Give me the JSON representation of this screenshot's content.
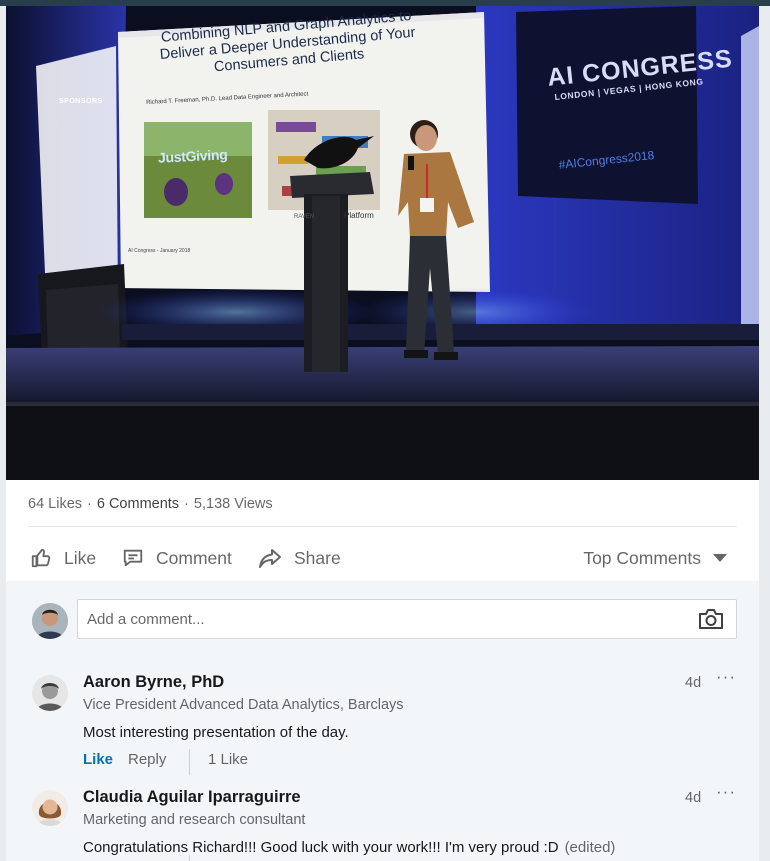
{
  "photo": {
    "slide_title": "Combining NLP and Graph Analytics to Deliver a Deeper Understanding of Your Consumers and Clients",
    "slide_author": "Richard T. Freeman, Ph.D.   Lead Data Engineer and Architect",
    "slide_footer": "AI Congress - January 2018",
    "justgiving_logo": "JustGiving",
    "raven_caption": "RAVEN",
    "platform_caption": "Platform",
    "sponsors_label": "SPONSORS",
    "congress_logo": "AI CONGRESS",
    "congress_cities": "LONDON | VEGAS | HONG KONG",
    "congress_hashtag": "#AICongress2018"
  },
  "social": {
    "likes": "64 Likes",
    "comments": "6 Comments",
    "views": "5,138 Views",
    "separator": "·"
  },
  "actions": {
    "like": "Like",
    "comment": "Comment",
    "share": "Share",
    "sort": "Top Comments"
  },
  "composer": {
    "placeholder": "Add a comment..."
  },
  "comments": [
    {
      "name": "Aaron Byrne, PhD",
      "headline": "Vice President Advanced Data Analytics, Barclays",
      "text": "Most interesting presentation of the day.",
      "time": "4d",
      "more": "···",
      "like_label": "Like",
      "reply_label": "Reply",
      "like_count": "1 Like"
    },
    {
      "name": "Claudia Aguilar Iparraguirre",
      "headline": "Marketing and research consultant",
      "text": "Congratulations Richard!!! Good luck with your work!!! I'm very proud :D",
      "edited": "(edited)",
      "time": "4d",
      "more": "···"
    }
  ],
  "colors": {
    "link_blue": "#0073b1",
    "muted_text": "#666666",
    "comments_bg": "#f3f6f8",
    "top_bar": "#283e4a"
  }
}
